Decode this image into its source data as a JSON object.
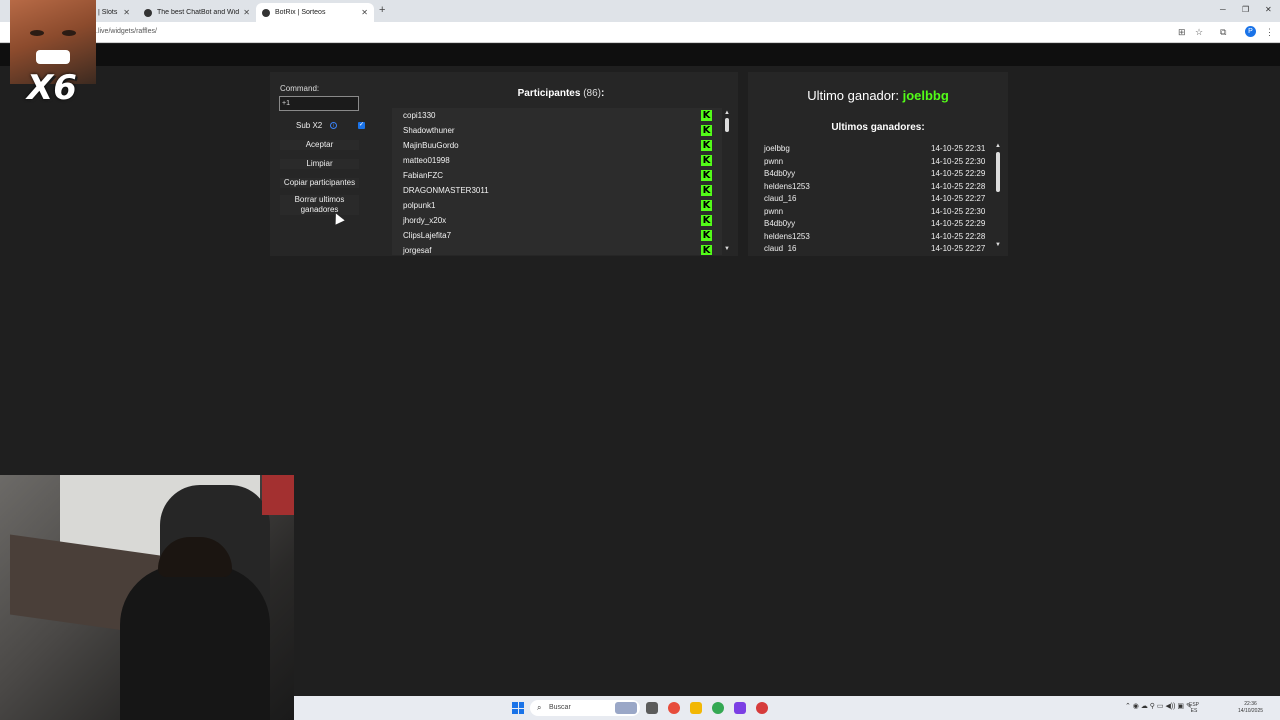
{
  "browser": {
    "tabs": [
      {
        "label": "| Slots o"
      },
      {
        "label": "The best ChatBot and Widget"
      },
      {
        "label": "BotRix | Sorteos"
      }
    ],
    "url": ".live/widgets/raffles/"
  },
  "overlay": {
    "multiplier": "X6"
  },
  "raffle": {
    "command_label": "Command:",
    "command_value": "+1",
    "sub_label": "Sub X2",
    "sub_checked": true,
    "buttons": {
      "accept": "Aceptar",
      "clear": "Limpiar",
      "copy": "Copiar participantes",
      "delete_winners_line1": "Borrar ultimos",
      "delete_winners_line2": "ganadores"
    },
    "participants_title": "Participantes",
    "participants_count": "(86)",
    "participants_colon": ":",
    "participants": [
      "copi1330",
      "Shadowthuner",
      "MajinBuuGordo",
      "matteo01998",
      "FabianFZC",
      "DRAGONMASTER3011",
      "polpunk1",
      "jhordy_x20x",
      "ClipsLajefita7",
      "jorgesaf"
    ],
    "platform_icon": "kick-icon",
    "last_winner_label": "Ultimo ganador:",
    "last_winner": "joelbbg",
    "winners_title": "Ultimos ganadores:",
    "winners": [
      {
        "name": "joelbbg",
        "date": "14-10-25 22:31"
      },
      {
        "name": "pwnn",
        "date": "14-10-25 22:30"
      },
      {
        "name": "B4db0yy",
        "date": "14-10-25 22:29"
      },
      {
        "name": "heldens1253",
        "date": "14-10-25 22:28"
      },
      {
        "name": "claud_16",
        "date": "14-10-25 22:27"
      },
      {
        "name": "pwnn",
        "date": "14-10-25 22:30"
      },
      {
        "name": "B4db0yy",
        "date": "14-10-25 22:29"
      },
      {
        "name": "heldens1253",
        "date": "14-10-25 22:28"
      },
      {
        "name": "claud_16",
        "date": "14-10-25 22:27"
      }
    ]
  },
  "taskbar": {
    "search_placeholder": "Buscar",
    "lang_line1": "ESP",
    "lang_line2": "ES",
    "time": "22:36",
    "date": "14/10/2025"
  },
  "colors": {
    "kick_green": "#53fc18",
    "panel": "#262626",
    "background": "#1f1f1f"
  }
}
